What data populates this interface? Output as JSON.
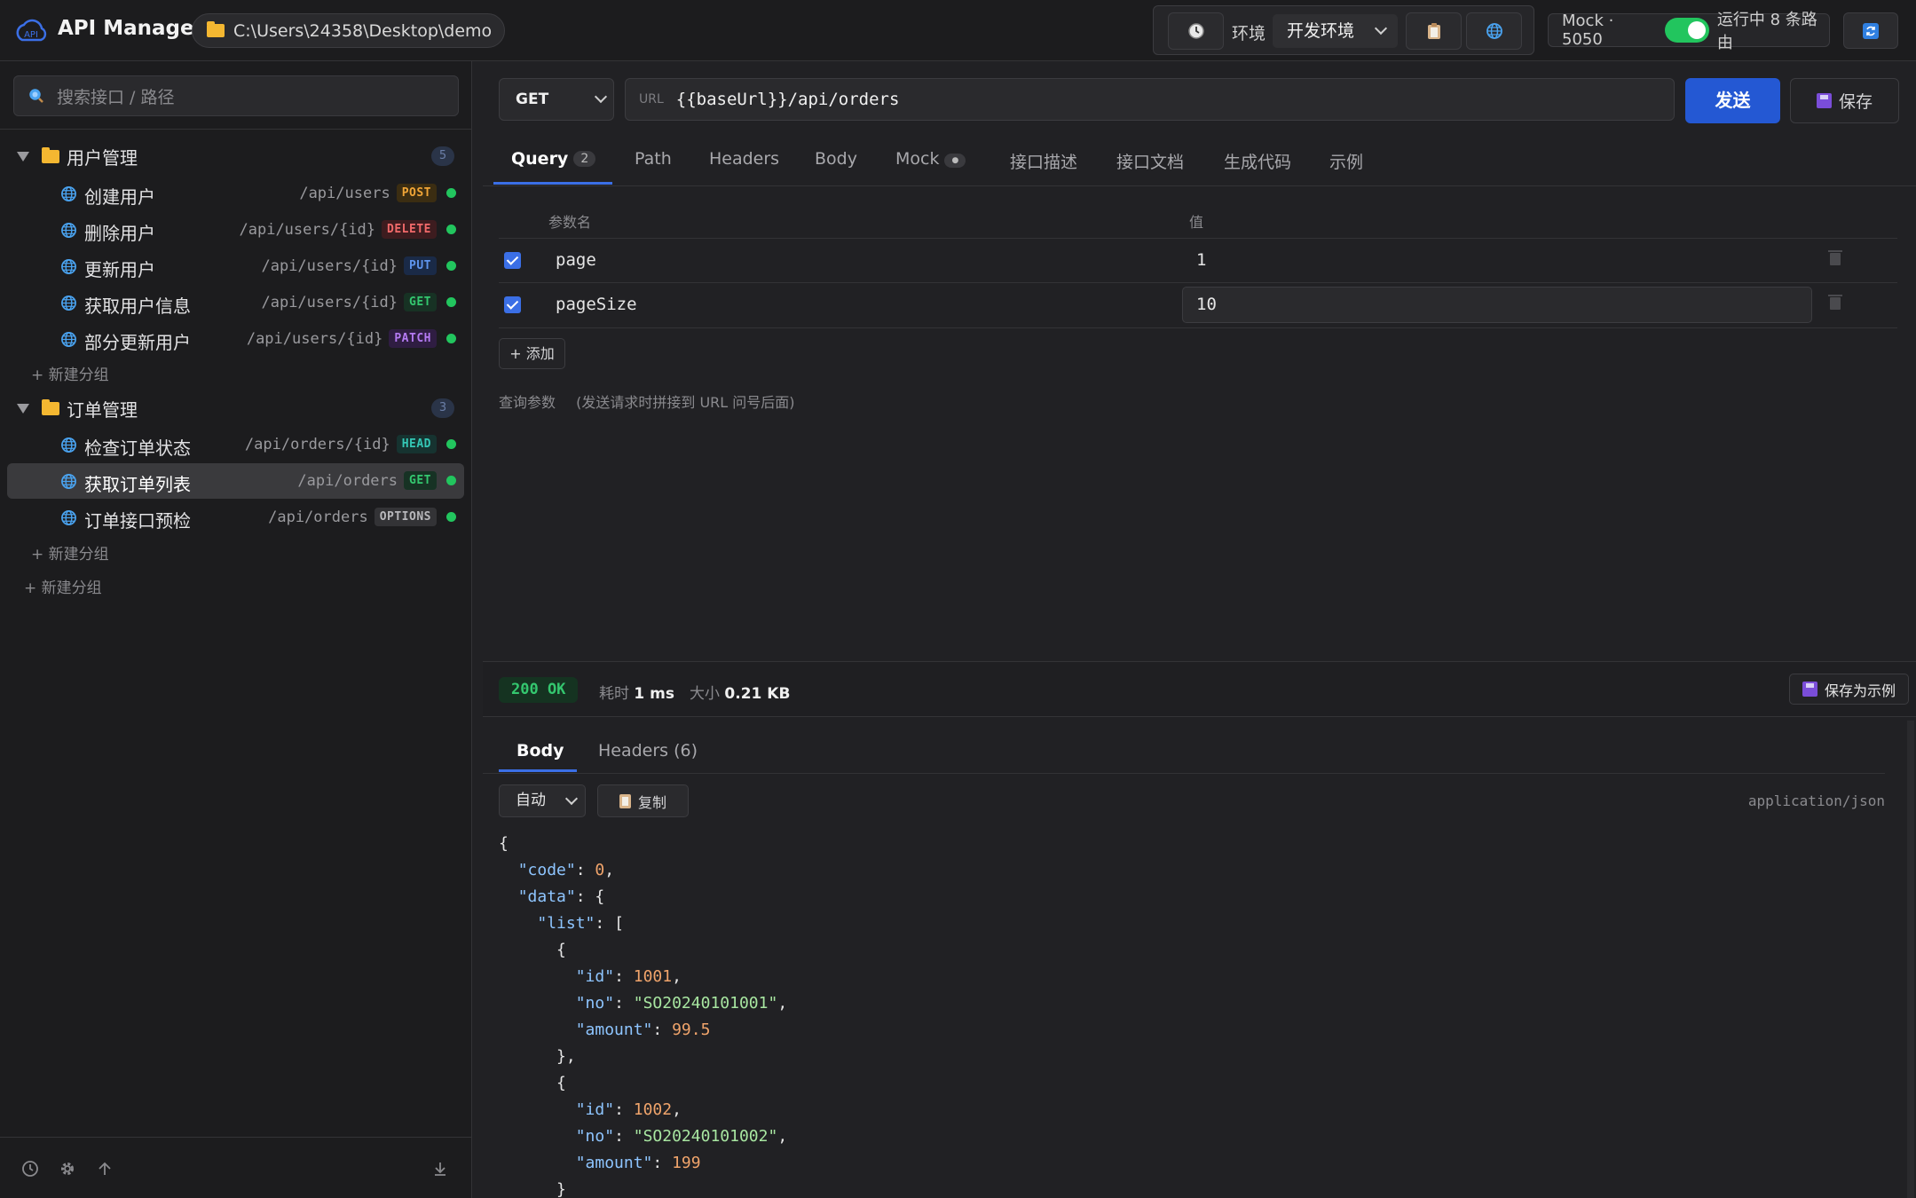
{
  "topbar": {
    "app_title": "API Manager",
    "project_path": "C:\\Users\\24358\\Desktop\\demo",
    "env_label": "环境",
    "env_selected": "开发环境",
    "mock_label": "Mock · 5050",
    "mock_enabled": true,
    "mock_status": "运行中 8 条路由",
    "icons": [
      "logo-icon",
      "folder-icon",
      "history-icon",
      "clipboard-icon",
      "globe-icon",
      "refresh-icon"
    ]
  },
  "sidebar": {
    "search_placeholder": "搜索接口 / 路径",
    "groups": [
      {
        "name": "用户管理",
        "count": "5",
        "items": [
          {
            "name": "创建用户",
            "path": "/api/users",
            "method": "POST"
          },
          {
            "name": "删除用户",
            "path": "/api/users/{id}",
            "method": "DELETE"
          },
          {
            "name": "更新用户",
            "path": "/api/users/{id}",
            "method": "PUT"
          },
          {
            "name": "获取用户信息",
            "path": "/api/users/{id}",
            "method": "GET"
          },
          {
            "name": "部分更新用户",
            "path": "/api/users/{id}",
            "method": "PATCH"
          }
        ],
        "new_subgroup": "新建分组"
      },
      {
        "name": "订单管理",
        "count": "3",
        "items": [
          {
            "name": "检查订单状态",
            "path": "/api/orders/{id}",
            "method": "HEAD"
          },
          {
            "name": "获取订单列表",
            "path": "/api/orders",
            "method": "GET"
          },
          {
            "name": "订单接口预检",
            "path": "/api/orders",
            "method": "OPTIONS"
          }
        ],
        "new_subgroup": "新建分组"
      }
    ],
    "new_group": "新建分组"
  },
  "request": {
    "method": "GET",
    "url_tag": "URL",
    "url": "{{baseUrl}}/api/orders",
    "send_label": "发送",
    "save_label": "保存",
    "tabs": [
      {
        "label": "Query",
        "badge": "2"
      },
      {
        "label": "Path"
      },
      {
        "label": "Headers"
      },
      {
        "label": "Body"
      },
      {
        "label": "Mock",
        "badge": "●"
      },
      {
        "label": "接口描述"
      },
      {
        "label": "接口文档"
      },
      {
        "label": "生成代码"
      },
      {
        "label": "示例"
      }
    ],
    "params_header": {
      "name": "参数名",
      "value": "值"
    },
    "params": [
      {
        "enabled": true,
        "name": "page",
        "value": "1"
      },
      {
        "enabled": true,
        "name": "pageSize",
        "value": "10"
      }
    ],
    "add_label": "+ 添加",
    "hint_title": "查询参数",
    "hint_text": "(发送请求时拼接到 URL 问号后面)"
  },
  "response": {
    "status": "200 OK",
    "time_label": "耗时",
    "time_value": "1 ms",
    "size_label": "大小",
    "size_value": "0.21 KB",
    "save_example": "保存为示例",
    "tabs": [
      "Body",
      "Headers (6)"
    ],
    "format": "自动",
    "copy_label": "复制",
    "content_type": "application/json"
  }
}
